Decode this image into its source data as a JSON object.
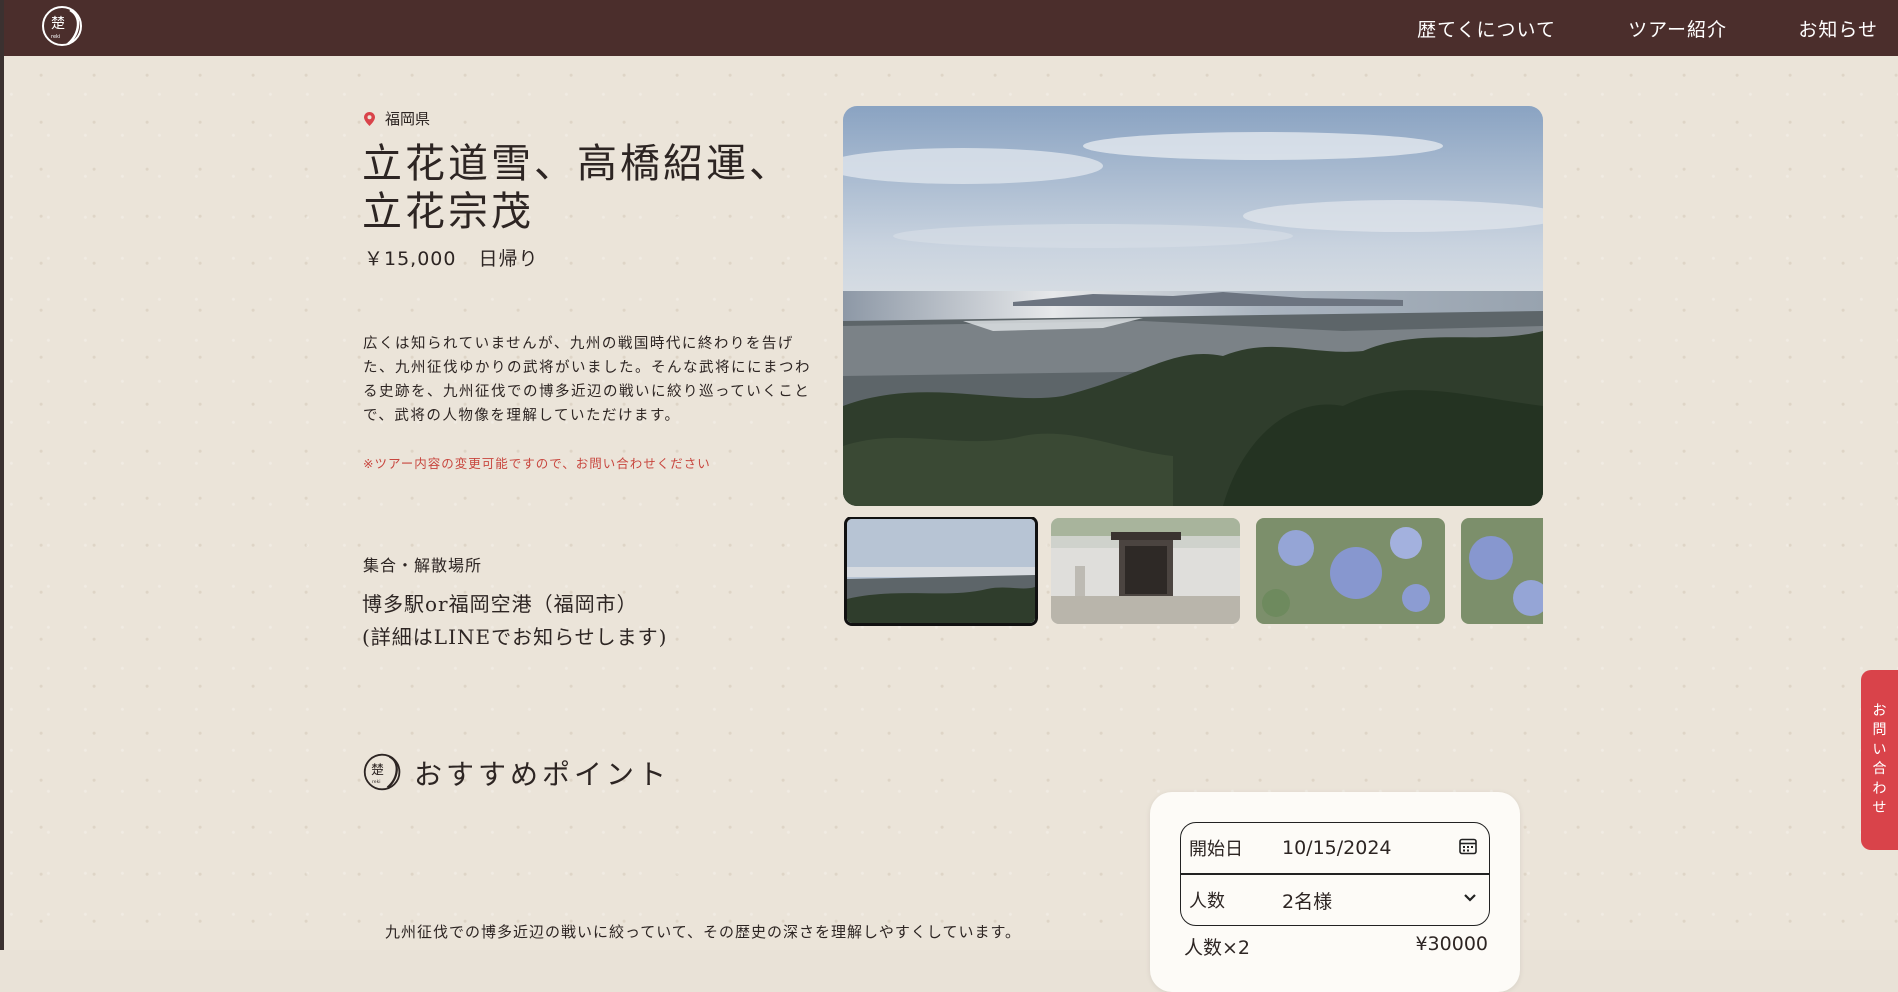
{
  "header": {
    "nav": [
      "歴てくについて",
      "ツアー紹介",
      "お知らせ"
    ]
  },
  "tour": {
    "location": "福岡県",
    "title": "立花道雪、高橋紹運、立花宗茂",
    "price": "￥15,000",
    "duration": "日帰り",
    "description": "広くは知られていませんが、九州の戦国時代に終わりを告げた、九州征伐ゆかりの武将がいました。そんな武将ににまつわる史跡を、九州征伐での博多近辺の戦いに絞り巡っていくことで、武将の人物像を理解していただけます。",
    "note": "※ツアー内容の変更可能ですので、お問い合わせください",
    "meeting_label": "集合・解散場所",
    "meeting_value": "博多駅or福岡空港（福岡市）\n(詳細はLINEでお知らせします)"
  },
  "recommend": {
    "title": "おすすめポイント",
    "text": "九州征伐での博多近辺の戦いに絞っていて、その歴史の深さを理解しやすくしています。"
  },
  "booking": {
    "date_label": "開始日",
    "date_value": "10/15/2024",
    "people_label": "人数",
    "people_value": "2名様",
    "sum_label": "人数×2",
    "sum_value": "¥30000"
  },
  "contact_label": "お問い合わせ",
  "colors": {
    "header_bg": "#4b2e2c",
    "page_bg": "#ebe4d9",
    "accent_red": "#d9434a",
    "note_red": "#c8463e"
  }
}
